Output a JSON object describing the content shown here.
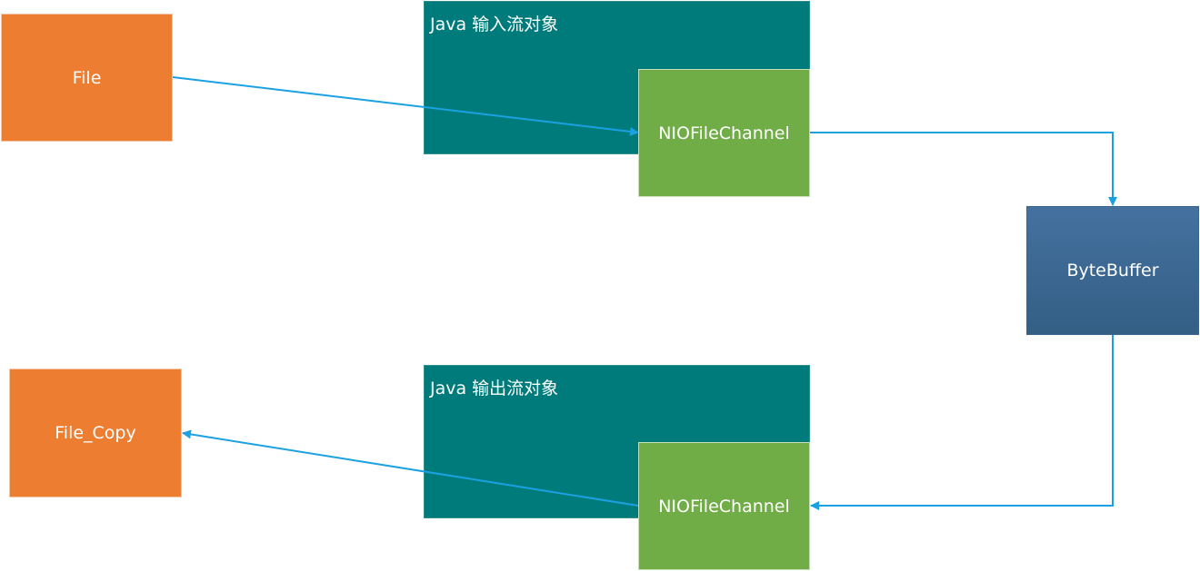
{
  "nodes": {
    "file": {
      "label": "File"
    },
    "file_copy": {
      "label": "File_Copy"
    },
    "input_stream": {
      "title": "Java 输入流对象"
    },
    "output_stream": {
      "title": "Java 输出流对象"
    },
    "input_channel": {
      "label": "NIOFileChannel"
    },
    "output_channel": {
      "label": "NIOFileChannel"
    },
    "byte_buffer": {
      "label": "ByteBuffer"
    }
  },
  "colors": {
    "file": "#ED7D31",
    "stream": "#007B7B",
    "channel": "#71AD47",
    "buffer": "#3A6790",
    "connector": "#1BA1E2"
  }
}
